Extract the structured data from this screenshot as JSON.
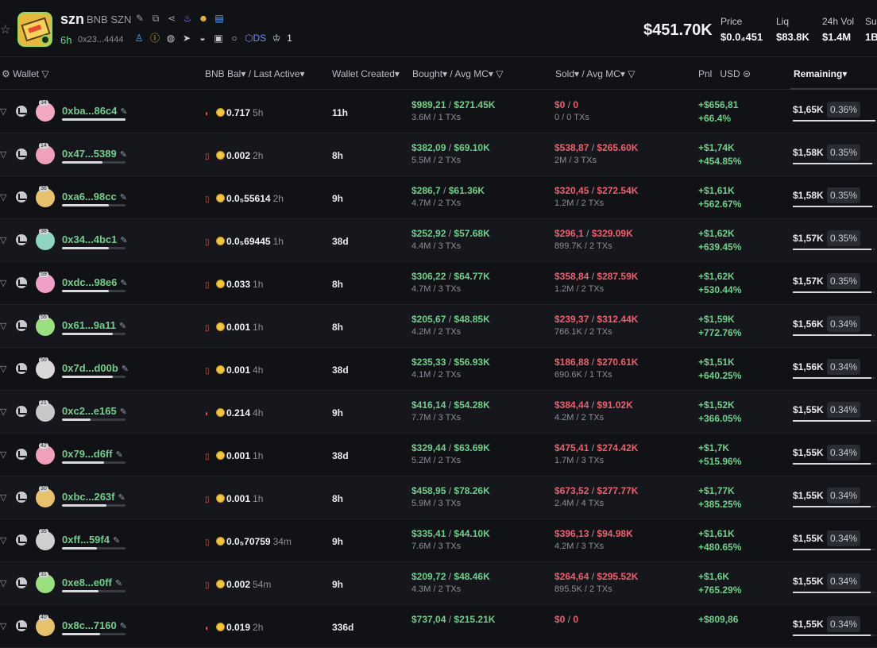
{
  "token": {
    "symbol": "szn",
    "full_name": "BNB SZN",
    "age": "6h",
    "address": "0x23...4444",
    "ds_label": "DS",
    "count": "1",
    "market_cap": "$451.70K",
    "stats": [
      {
        "label": "Price",
        "value": "$0.0₄451"
      },
      {
        "label": "Liq",
        "value": "$83.8K"
      },
      {
        "label": "24h Vol",
        "value": "$1.4M"
      },
      {
        "label": "Sup",
        "value": "1B"
      }
    ]
  },
  "columns": {
    "wallet": "Wallet",
    "bnb_bal": "BNB Bal",
    "last_active": "/ Last Active",
    "wallet_created": "Wallet Created",
    "bought": "Bought",
    "avg_mc_buy": "/ Avg MC",
    "sold": "Sold",
    "avg_mc_sell": "/ Avg MC",
    "pnl": "Pnl",
    "usd": "USD",
    "remaining": "Remaining"
  },
  "rows": [
    {
      "addr": "0xba...86c4",
      "bar": 1.0,
      "mark": true,
      "bal": "0.717",
      "time": "5h",
      "created": "11h",
      "bought": "$989,21",
      "bought_mc": "$271.45K",
      "bought_sub": "3.6M / 1 TXs",
      "sold": "$0",
      "sold_mc": "0",
      "sold_sub": "0 / 0 TXs",
      "pnl_usd": "+$656,81",
      "pnl_pct": "+66.4%",
      "remaining": "$1,65K",
      "rem_pct": "0.36%",
      "rem_frac": 1.0,
      "avatar": "#f2a8c0",
      "lvl": "34"
    },
    {
      "addr": "0x47...5389",
      "bar": 0.64,
      "mark": false,
      "bal": "0.002",
      "time": "2h",
      "created": "8h",
      "bought": "$382,09",
      "bought_mc": "$69.10K",
      "bought_sub": "5.5M / 2 TXs",
      "sold": "$538,87",
      "sold_mc": "$265.60K",
      "sold_sub": "2M / 3 TXs",
      "pnl_usd": "+$1,74K",
      "pnl_pct": "+454.85%",
      "remaining": "$1,58K",
      "rem_pct": "0.35%",
      "rem_frac": 0.96,
      "avatar": "#f0a0b8",
      "lvl": "14"
    },
    {
      "addr": "0xa6...98cc",
      "bar": 0.74,
      "mark": false,
      "bal": "0.0₅55614",
      "time": "2h",
      "created": "9h",
      "bought": "$286,7",
      "bought_mc": "$61.36K",
      "bought_sub": "4.7M / 2 TXs",
      "sold": "$320,45",
      "sold_mc": "$272.54K",
      "sold_sub": "1.2M / 2 TXs",
      "pnl_usd": "+$1,61K",
      "pnl_pct": "+562.67%",
      "remaining": "$1,58K",
      "rem_pct": "0.35%",
      "rem_frac": 0.96,
      "avatar": "#e8c26a",
      "lvl": "36"
    },
    {
      "addr": "0x34...4bc1",
      "bar": 0.74,
      "mark": false,
      "bal": "0.0₅69445",
      "time": "1h",
      "created": "38d",
      "bought": "$252,92",
      "bought_mc": "$57.68K",
      "bought_sub": "4.4M / 3 TXs",
      "sold": "$296,1",
      "sold_mc": "$329.09K",
      "sold_sub": "899.7K / 2 TXs",
      "pnl_usd": "+$1,62K",
      "pnl_pct": "+639.45%",
      "remaining": "$1,57K",
      "rem_pct": "0.35%",
      "rem_frac": 0.95,
      "avatar": "#8fd6c0",
      "lvl": "38"
    },
    {
      "addr": "0xdc...98e6",
      "bar": 0.74,
      "mark": false,
      "bal": "0.033",
      "time": "1h",
      "created": "8h",
      "bought": "$306,22",
      "bought_mc": "$64.77K",
      "bought_sub": "4.7M / 3 TXs",
      "sold": "$358,84",
      "sold_mc": "$287.59K",
      "sold_sub": "1.2M / 2 TXs",
      "pnl_usd": "+$1,62K",
      "pnl_pct": "+530.44%",
      "remaining": "$1,57K",
      "rem_pct": "0.35%",
      "rem_frac": 0.95,
      "avatar": "#f0a0c8",
      "lvl": "59"
    },
    {
      "addr": "0x61...9a11",
      "bar": 0.8,
      "mark": false,
      "bal": "0.001",
      "time": "1h",
      "created": "8h",
      "bought": "$205,67",
      "bought_mc": "$48.85K",
      "bought_sub": "4.2M / 2 TXs",
      "sold": "$239,37",
      "sold_mc": "$312.44K",
      "sold_sub": "766.1K / 2 TXs",
      "pnl_usd": "+$1,59K",
      "pnl_pct": "+772.76%",
      "remaining": "$1,56K",
      "rem_pct": "0.34%",
      "rem_frac": 0.95,
      "avatar": "#9be080",
      "lvl": "55"
    },
    {
      "addr": "0x7d...d00b",
      "bar": 0.8,
      "mark": false,
      "bal": "0.001",
      "time": "4h",
      "created": "38d",
      "bought": "$235,33",
      "bought_mc": "$56.93K",
      "bought_sub": "4.1M / 2 TXs",
      "sold": "$186,88",
      "sold_mc": "$270.61K",
      "sold_sub": "690.6K / 1 TXs",
      "pnl_usd": "+$1,51K",
      "pnl_pct": "+640.25%",
      "remaining": "$1,56K",
      "rem_pct": "0.34%",
      "rem_frac": 0.95,
      "avatar": "#d8d8d8",
      "lvl": "50"
    },
    {
      "addr": "0xc2...e165",
      "bar": 0.45,
      "mark": true,
      "bal": "0.214",
      "time": "4h",
      "created": "9h",
      "bought": "$416,14",
      "bought_mc": "$54.28K",
      "bought_sub": "7.7M / 3 TXs",
      "sold": "$384,44",
      "sold_mc": "$91.02K",
      "sold_sub": "4.2M / 2 TXs",
      "pnl_usd": "+$1,52K",
      "pnl_pct": "+366.05%",
      "remaining": "$1,55K",
      "rem_pct": "0.34%",
      "rem_frac": 0.94,
      "avatar": "#c8c8c8",
      "lvl": "21"
    },
    {
      "addr": "0x79...d6ff",
      "bar": 0.66,
      "mark": false,
      "bal": "0.001",
      "time": "1h",
      "created": "38d",
      "bought": "$329,44",
      "bought_mc": "$63.69K",
      "bought_sub": "5.2M / 2 TXs",
      "sold": "$475,41",
      "sold_mc": "$274.42K",
      "sold_sub": "1.7M / 3 TXs",
      "pnl_usd": "+$1,7K",
      "pnl_pct": "+515.96%",
      "remaining": "$1,55K",
      "rem_pct": "0.34%",
      "rem_frac": 0.94,
      "avatar": "#f0a0b8",
      "lvl": "42"
    },
    {
      "addr": "0xbc...263f",
      "bar": 0.7,
      "mark": false,
      "bal": "0.001",
      "time": "1h",
      "created": "8h",
      "bought": "$458,95",
      "bought_mc": "$78.26K",
      "bought_sub": "5.9M / 3 TXs",
      "sold": "$673,52",
      "sold_mc": "$277.77K",
      "sold_sub": "2.4M / 4 TXs",
      "pnl_usd": "+$1,77K",
      "pnl_pct": "+385.25%",
      "remaining": "$1,55K",
      "rem_pct": "0.34%",
      "rem_frac": 0.94,
      "avatar": "#e8c26a",
      "lvl": "30"
    },
    {
      "addr": "0xff...59f4",
      "bar": 0.55,
      "mark": false,
      "bal": "0.0₅70759",
      "time": "34m",
      "created": "9h",
      "bought": "$335,41",
      "bought_mc": "$44.10K",
      "bought_sub": "7.6M / 3 TXs",
      "sold": "$396,13",
      "sold_mc": "$94.98K",
      "sold_sub": "4.2M / 3 TXs",
      "pnl_usd": "+$1,61K",
      "pnl_pct": "+480.65%",
      "remaining": "$1,55K",
      "rem_pct": "0.34%",
      "rem_frac": 0.94,
      "avatar": "#d0d0d0",
      "lvl": "35"
    },
    {
      "addr": "0xe8...e0ff",
      "bar": 0.58,
      "mark": false,
      "bal": "0.002",
      "time": "54m",
      "created": "9h",
      "bought": "$209,72",
      "bought_mc": "$48.46K",
      "bought_sub": "4.3M / 2 TXs",
      "sold": "$264,64",
      "sold_mc": "$295.52K",
      "sold_sub": "895.5K / 2 TXs",
      "pnl_usd": "+$1,6K",
      "pnl_pct": "+765.29%",
      "remaining": "$1,55K",
      "rem_pct": "0.34%",
      "rem_frac": 0.94,
      "avatar": "#9be080",
      "lvl": "31"
    },
    {
      "addr": "0x8c...7160",
      "bar": 0.6,
      "mark": true,
      "bal": "0.019",
      "time": "2h",
      "created": "336d",
      "bought": "$737,04",
      "bought_mc": "$215.21K",
      "bought_sub": "",
      "sold": "$0",
      "sold_mc": "0",
      "sold_sub": "",
      "pnl_usd": "+$809,86",
      "pnl_pct": "",
      "remaining": "$1,55K",
      "rem_pct": "0.34%",
      "rem_frac": 0.94,
      "avatar": "#e8c26a",
      "lvl": "40"
    }
  ]
}
